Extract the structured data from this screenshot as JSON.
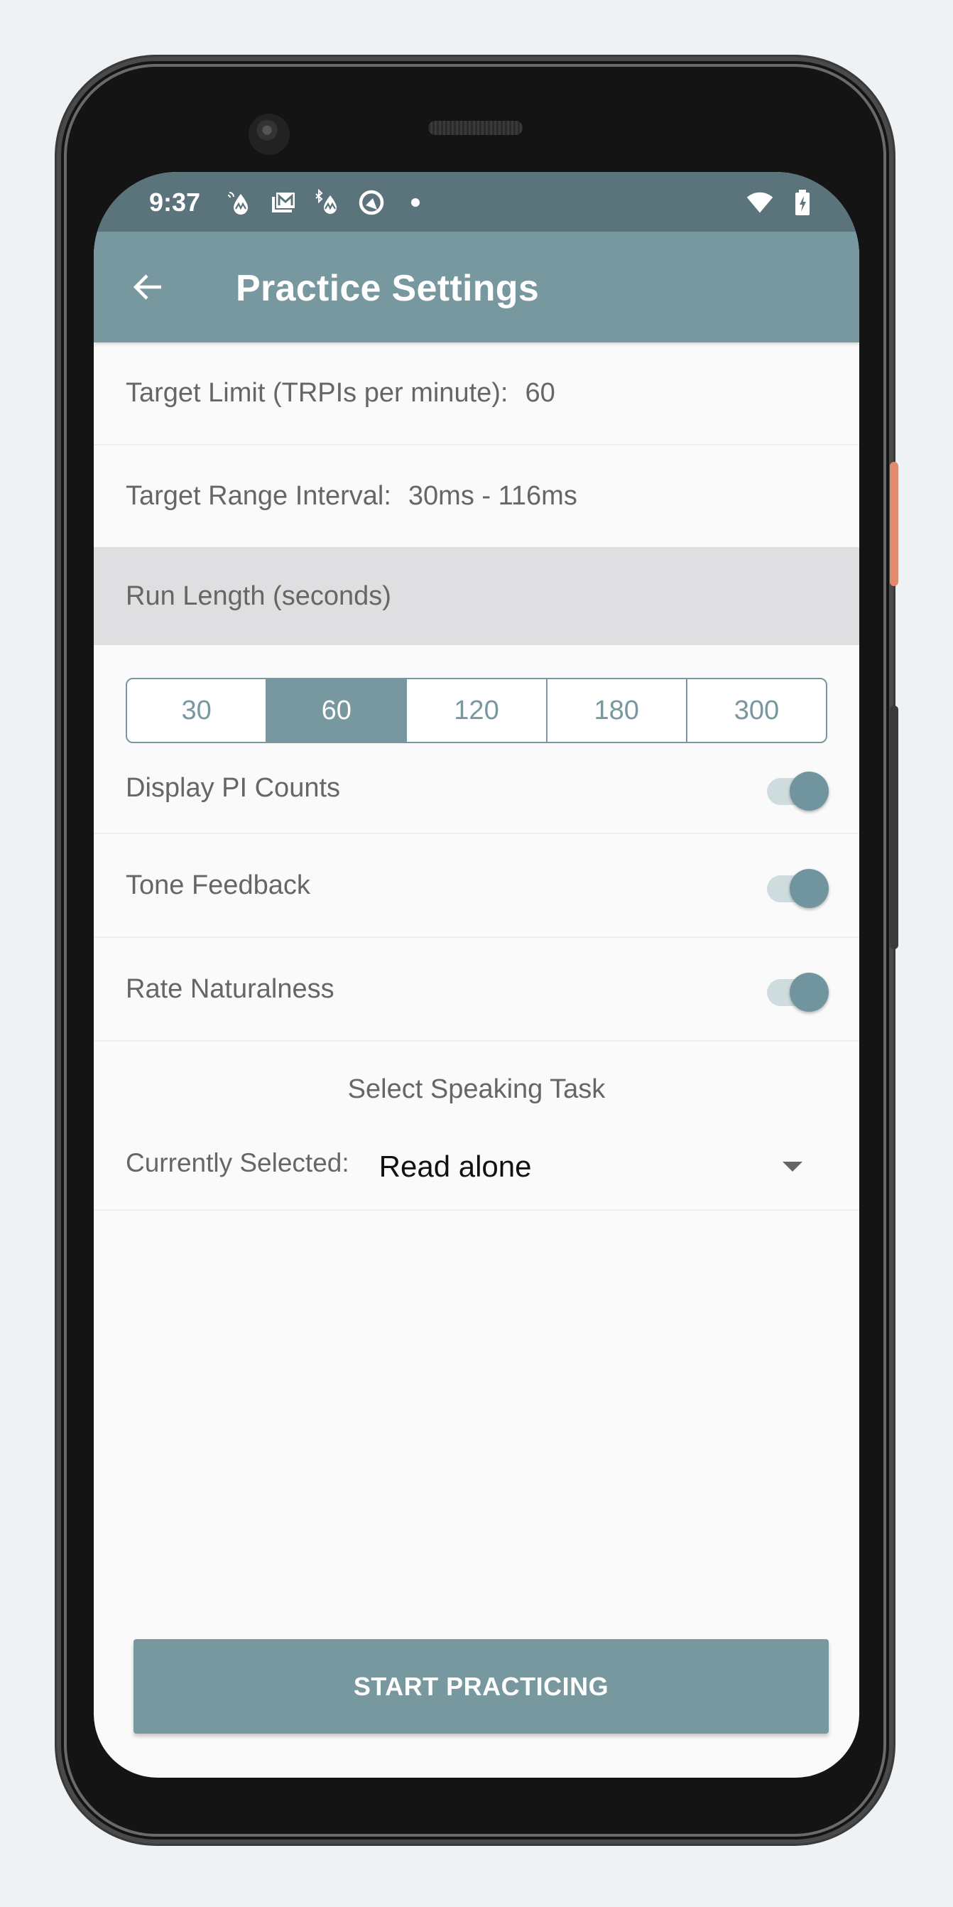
{
  "status_bar": {
    "time": "9:37",
    "notification_icons": [
      "nfc-drop-icon",
      "gmail-stack-icon",
      "bluetooth-drop-icon",
      "q-circle-icon",
      "more-dot-icon"
    ],
    "system_icons": [
      "wifi-icon",
      "battery-charging-icon"
    ]
  },
  "app_bar": {
    "back_icon": "arrow-left-icon",
    "title": "Practice Settings"
  },
  "settings": {
    "target_limit": {
      "label": "Target Limit (TRPIs per minute):",
      "value": "60"
    },
    "target_range": {
      "label": "Target Range Interval:",
      "value": "30ms - 116ms"
    },
    "run_length": {
      "header": "Run Length (seconds)",
      "options": [
        "30",
        "60",
        "120",
        "180",
        "300"
      ],
      "selected": "60"
    },
    "toggles": [
      {
        "label": "Display PI Counts",
        "on": true
      },
      {
        "label": "Tone Feedback",
        "on": true
      },
      {
        "label": "Rate Naturalness",
        "on": true
      }
    ],
    "speaking_task": {
      "heading": "Select Speaking Task",
      "current_label": "Currently Selected:",
      "selected_value": "Read alone"
    }
  },
  "actions": {
    "start_label": "START PRACTICING"
  },
  "colors": {
    "primary": "#78989f",
    "status_bar": "#5b737b",
    "section_header": "#dfdfe2",
    "background": "#fafafa"
  }
}
